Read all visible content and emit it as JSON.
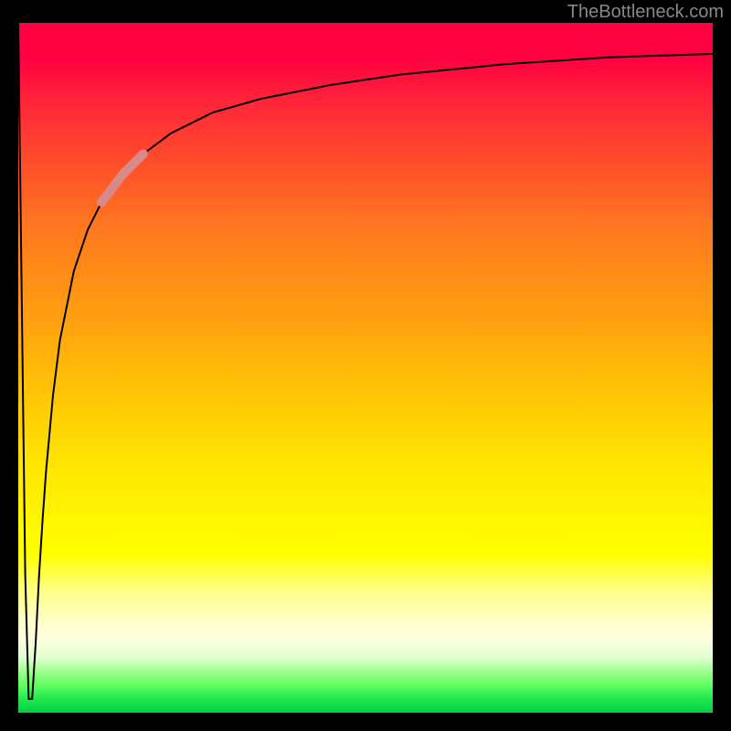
{
  "watermark": "TheBottleneck.com",
  "chart_data": {
    "type": "line",
    "title": "",
    "xlabel": "",
    "ylabel": "",
    "xlim": [
      0,
      100
    ],
    "ylim": [
      0,
      100
    ],
    "series": [
      {
        "name": "bottleneck-curve",
        "x": [
          0,
          0.5,
          1,
          1.5,
          2,
          2.5,
          3,
          3.5,
          4,
          5,
          6,
          8,
          10,
          12,
          15,
          18,
          22,
          28,
          35,
          45,
          55,
          70,
          85,
          100
        ],
        "values": [
          100,
          60,
          20,
          2,
          2,
          10,
          20,
          28,
          35,
          46,
          54,
          64,
          70,
          74,
          78,
          81,
          84,
          87,
          89,
          91,
          92.5,
          94,
          95,
          95.5
        ]
      }
    ],
    "highlight_region": {
      "x_start": 12,
      "x_end": 18,
      "description": "faded-pink-segment"
    },
    "background_gradient": {
      "type": "vertical",
      "colors_top_to_bottom": [
        "red-magenta",
        "orange",
        "yellow",
        "pale-yellow",
        "green"
      ]
    }
  }
}
